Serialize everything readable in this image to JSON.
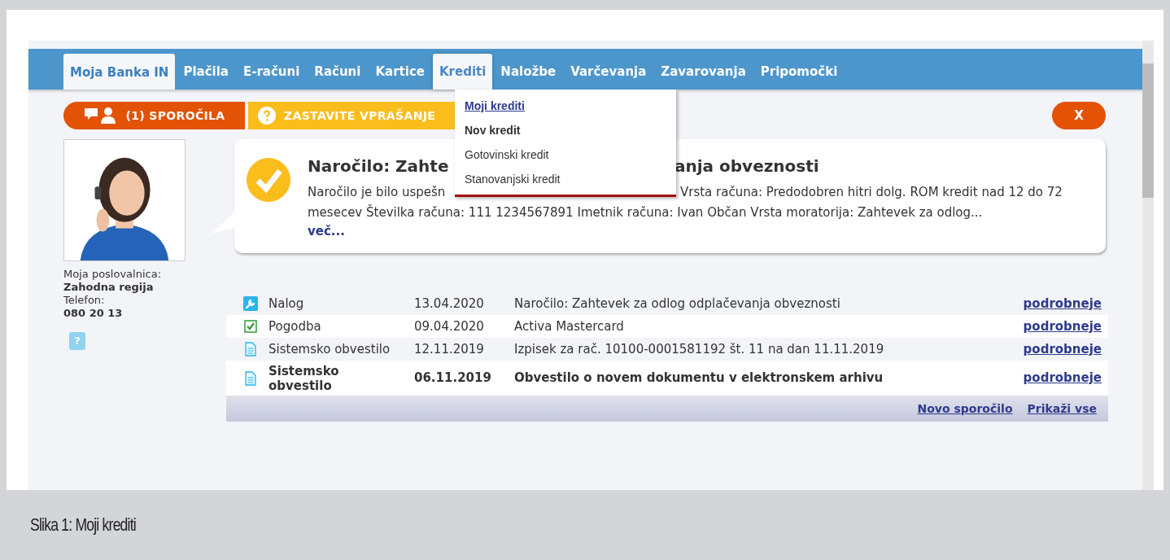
{
  "nav": {
    "tabs": [
      {
        "label": "Moja Banka IN",
        "selected": true,
        "expanded": false
      },
      {
        "label": "Plačila",
        "selected": false,
        "expanded": false
      },
      {
        "label": "E-računi",
        "selected": false,
        "expanded": false
      },
      {
        "label": "Računi",
        "selected": false,
        "expanded": false
      },
      {
        "label": "Kartice",
        "selected": false,
        "expanded": false
      },
      {
        "label": "Krediti",
        "selected": false,
        "expanded": true
      },
      {
        "label": "Naložbe",
        "selected": false,
        "expanded": false
      },
      {
        "label": "Varčevanja",
        "selected": false,
        "expanded": false
      },
      {
        "label": "Zavarovanja",
        "selected": false,
        "expanded": false
      },
      {
        "label": "Pripomočki",
        "selected": false,
        "expanded": false
      }
    ]
  },
  "dropdown": {
    "items": [
      {
        "label": "Moji krediti",
        "kind": "link"
      },
      {
        "label": "Nov kredit",
        "kind": "heading"
      },
      {
        "label": "Gotovinski kredit",
        "kind": "item"
      },
      {
        "label": "Stanovanjski kredit",
        "kind": "item"
      }
    ]
  },
  "actions": {
    "messages_button": "(1) SPOROČILA",
    "ask_button": "ZASTAVITE VPRAŠANJE",
    "close_button": "X"
  },
  "branch": {
    "label": "Moja poslovalnica:",
    "name": "Zahodna regija",
    "phone_label": "Telefon:",
    "phone": "080 20 13",
    "help_button": "?"
  },
  "notice": {
    "title_start": "Naročilo: Zahte",
    "title_end": "anja obveznosti",
    "text_start": "Naročilo je bilo uspešn",
    "text_end": "Vrsta računa: Predodobren hitri dolg. ROM kredit nad 12 do 72",
    "text_line_2": "mesecev Številka računa: 111 1234567891 Imetnik računa: Ivan Občan Vrsta moratorija: Zahtevek za odlog...",
    "more": "več..."
  },
  "messages": {
    "rows": [
      {
        "kind": "tool",
        "type": "Nalog",
        "date": "13.04.2020",
        "subject": "Naročilo: Zahtevek za odlog odplačevanja obveznosti",
        "link": "podrobneje",
        "unread": false
      },
      {
        "kind": "check",
        "type": "Pogodba",
        "date": "09.04.2020",
        "subject": "Activa Mastercard",
        "link": "podrobneje",
        "unread": false
      },
      {
        "kind": "document",
        "type": "Sistemsko obvestilo",
        "date": "12.11.2019",
        "subject": "Izpisek za rač. 10100-0001581192 št. 11 na dan 11.11.2019",
        "link": "podrobneje",
        "unread": false
      },
      {
        "kind": "document",
        "type": "Sistemsko obvestilo",
        "date": "06.11.2019",
        "subject": "Obvestilo o novem dokumentu v elektronskem arhivu",
        "link": "podrobneje",
        "unread": true
      }
    ],
    "footer_links": [
      "Novo sporočilo",
      "Prikaži vse"
    ]
  },
  "caption": "Slika 1: Moji krediti"
}
